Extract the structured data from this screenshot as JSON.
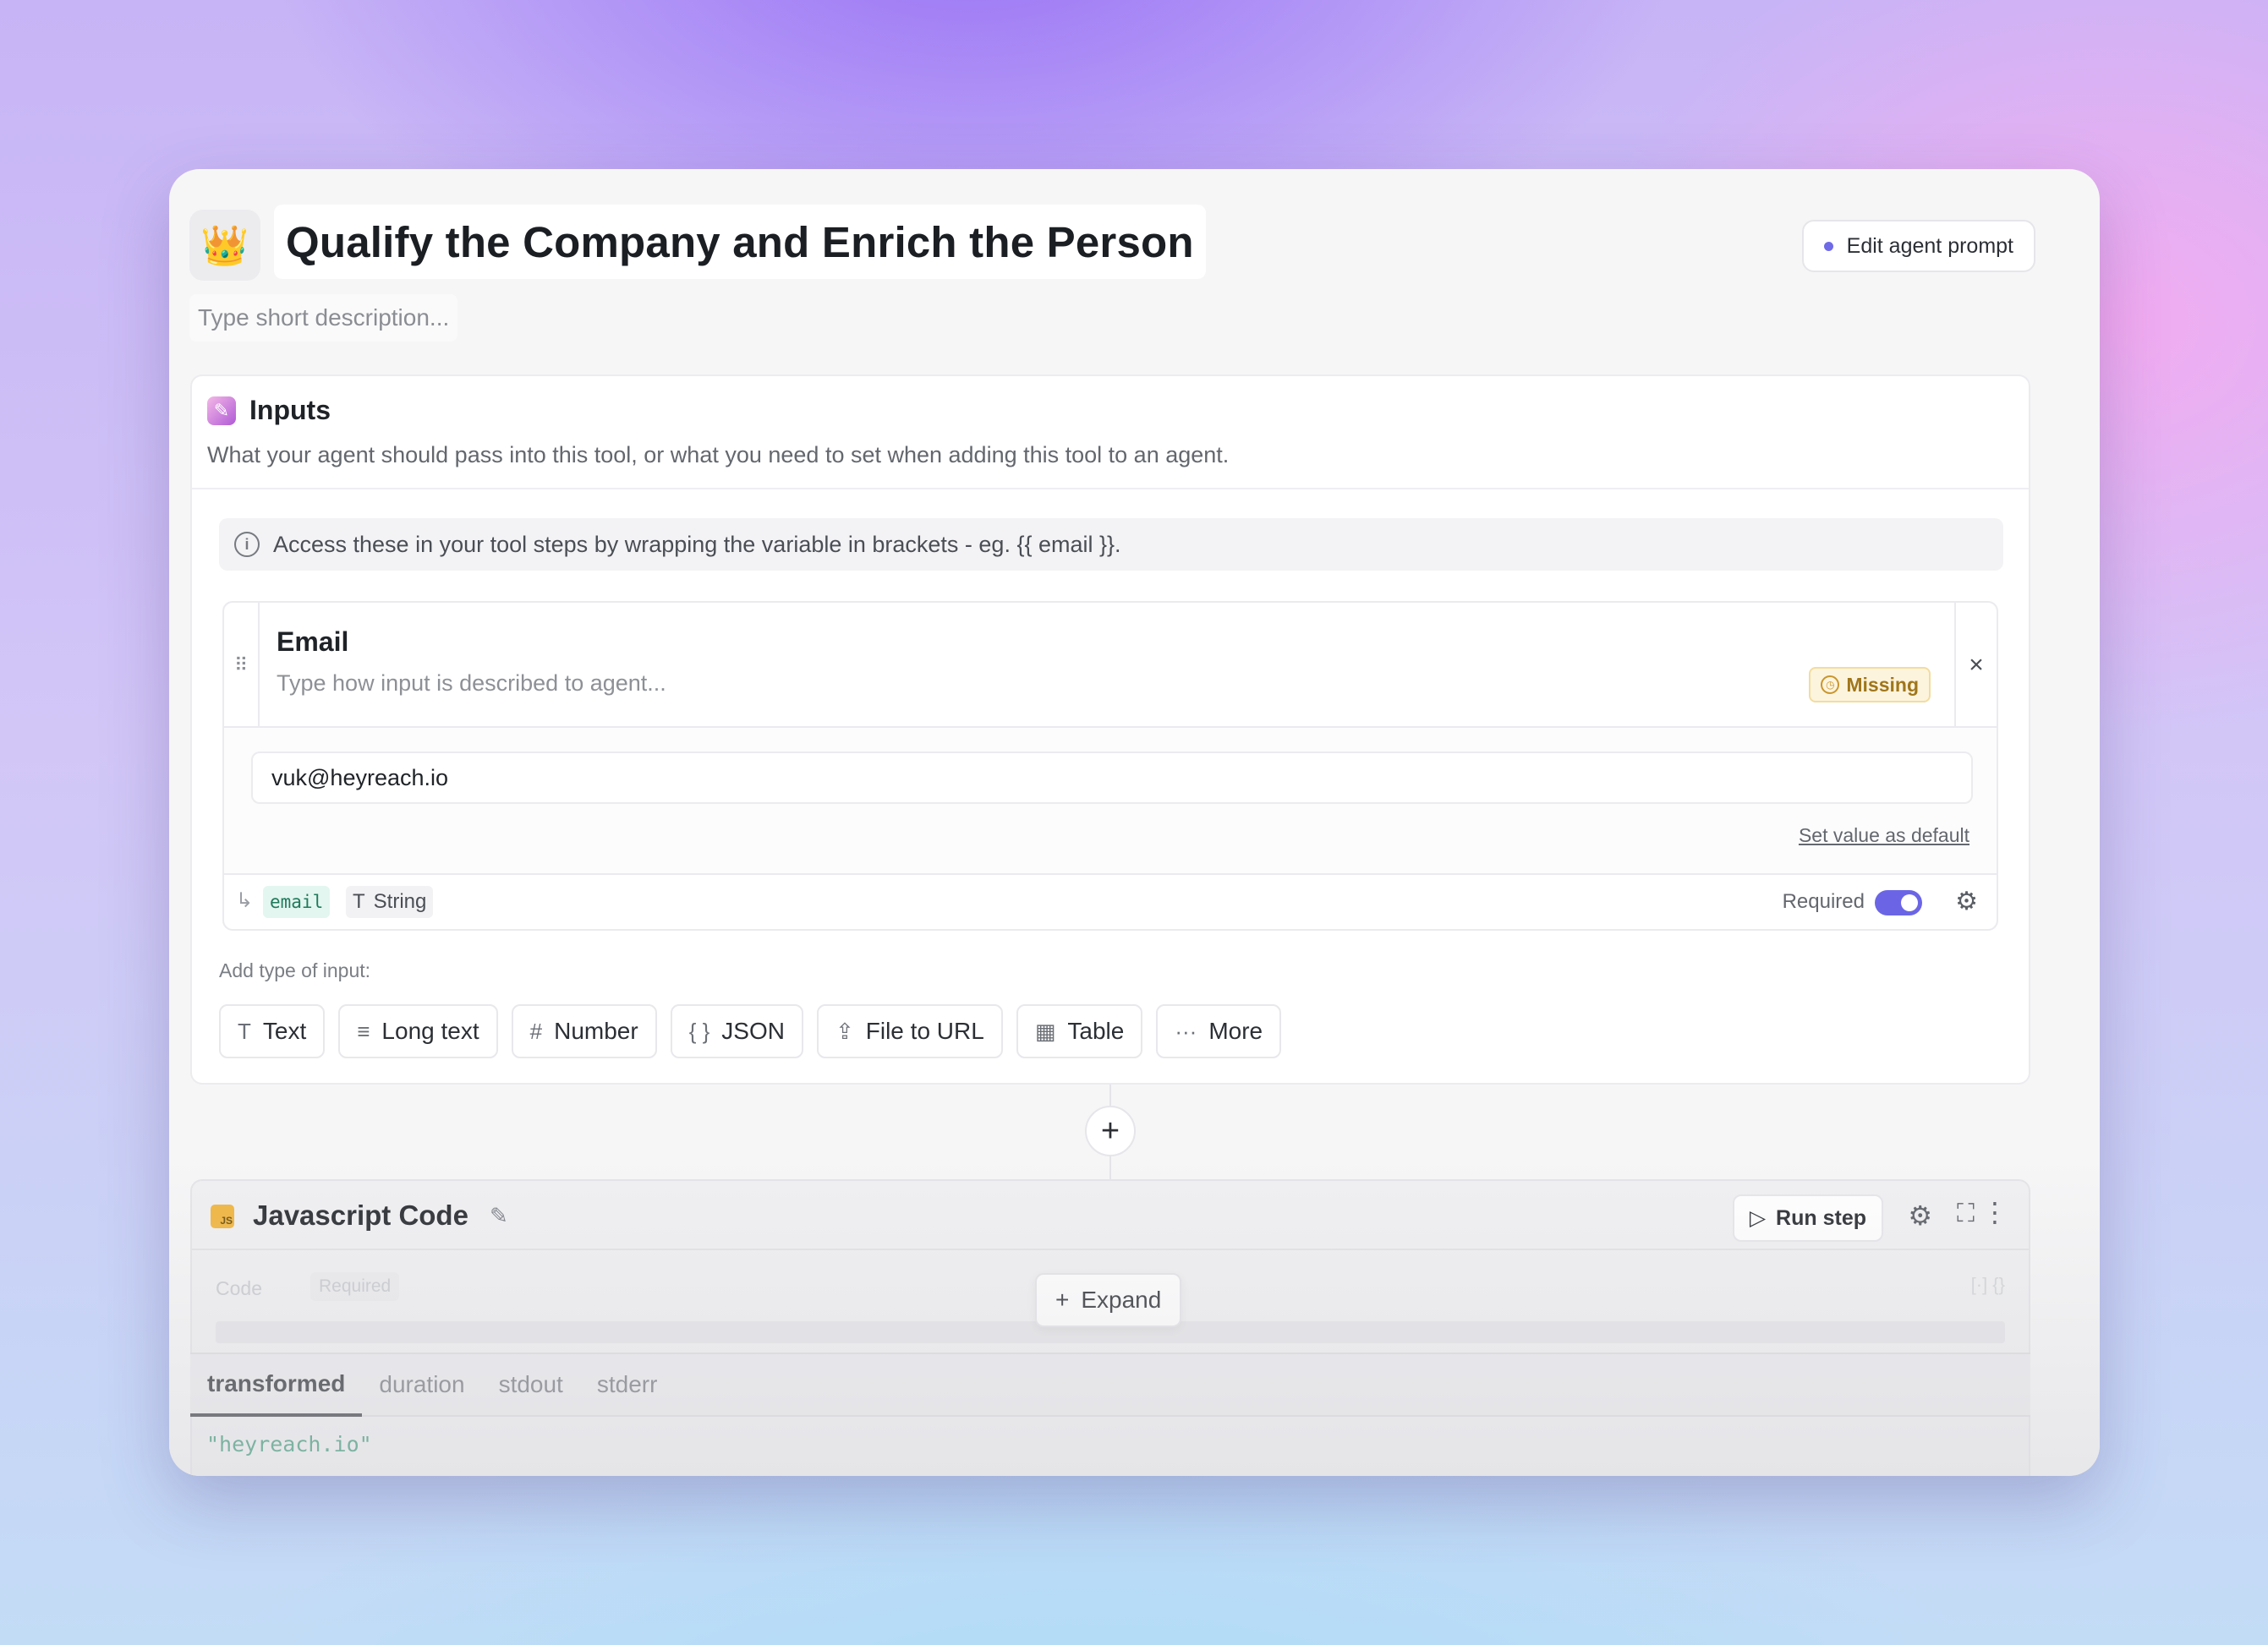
{
  "header": {
    "emoji": "👑",
    "title": "Qualify the Company and Enrich the Person",
    "description_placeholder": "Type short description...",
    "edit_prompt_label": "Edit agent prompt"
  },
  "inputs": {
    "icon": "brush-icon",
    "title": "Inputs",
    "subtitle": "What your agent should pass into this tool, or what you need to set when adding this tool to an agent.",
    "info": "Access these in your tool steps by wrapping the variable in brackets - eg. {{ email }}.",
    "field": {
      "name": "Email",
      "description_placeholder": "Type how input is described to agent...",
      "status": "Missing",
      "status_color": "#a0761b",
      "value": "vuk@heyreach.io",
      "set_default_label": "Set value as default",
      "variable": "email",
      "type": "String",
      "required_label": "Required",
      "required": true
    },
    "add_type_label": "Add type of input:",
    "type_buttons": [
      {
        "icon": "T",
        "label": "Text"
      },
      {
        "icon": "≡",
        "label": "Long text"
      },
      {
        "icon": "#",
        "label": "Number"
      },
      {
        "icon": "{ }",
        "label": "JSON"
      },
      {
        "icon": "⇪",
        "label": "File to URL"
      },
      {
        "icon": "▦",
        "label": "Table"
      },
      {
        "icon": "···",
        "label": "More"
      }
    ]
  },
  "step": {
    "title": "Javascript Code",
    "icon_text": "JS",
    "run_label": "Run step",
    "code_label": "Code",
    "code_required": "Required",
    "expand_label": "Expand"
  },
  "output": {
    "tabs": [
      "transformed",
      "duration",
      "stdout",
      "stderr"
    ],
    "active_tab": "transformed",
    "value": "\"heyreach.io\""
  },
  "colors": {
    "accent": "#6b65e6",
    "variable_chip": "#e3f6ef",
    "output_text": "#1f8a63"
  }
}
